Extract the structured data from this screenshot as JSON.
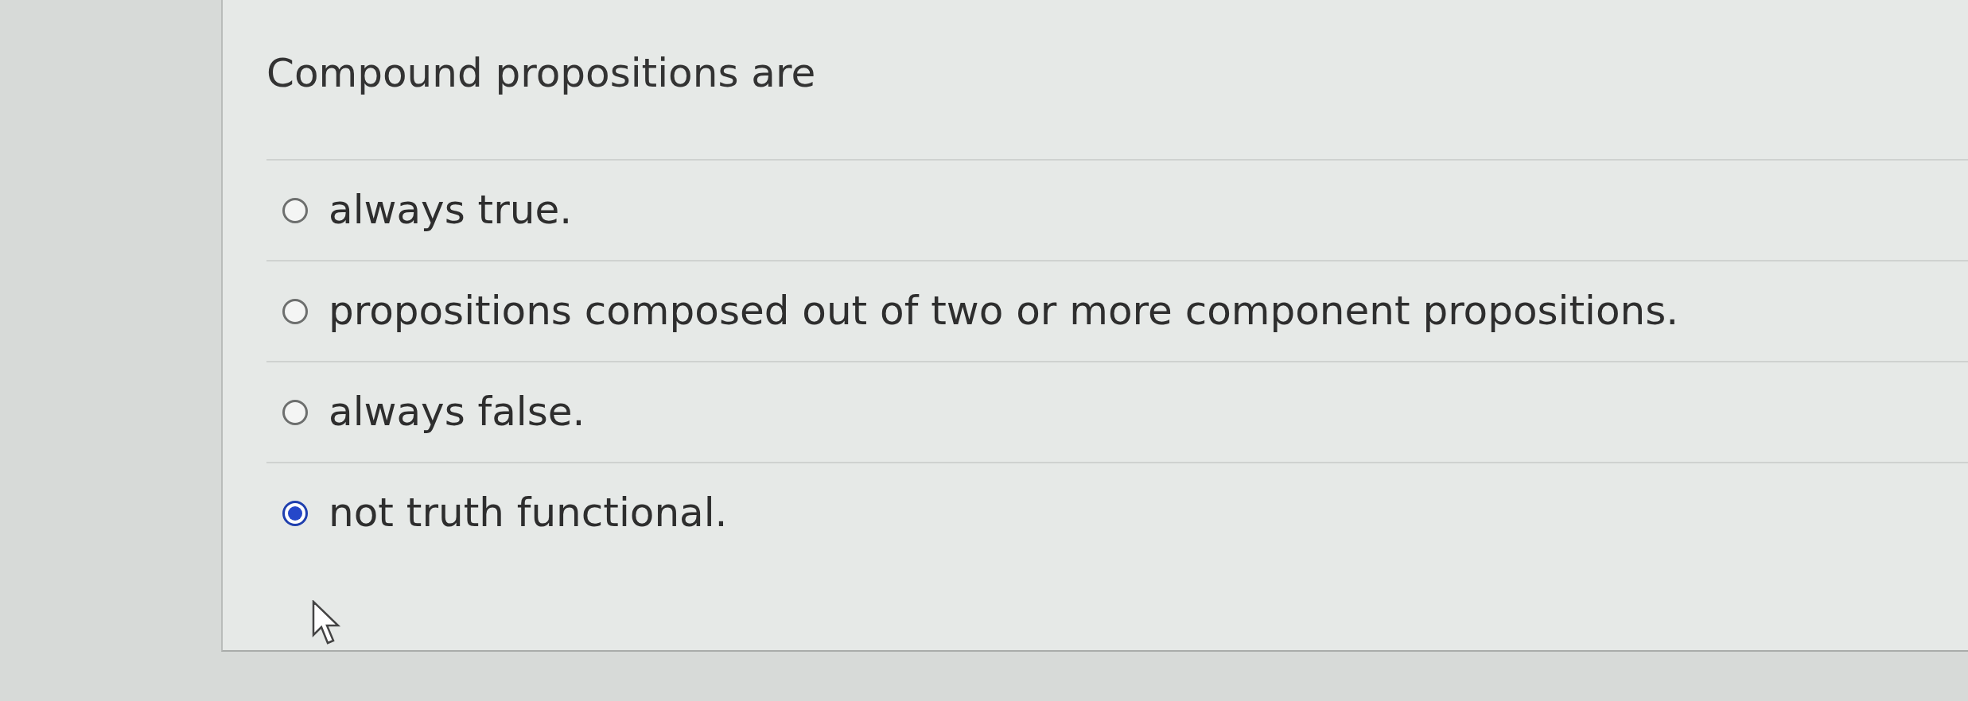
{
  "question": "Compound propositions are",
  "options": [
    {
      "label": "always true.",
      "selected": false
    },
    {
      "label": "propositions composed out of two or more component propositions.",
      "selected": false
    },
    {
      "label": "always false.",
      "selected": false
    },
    {
      "label": "not truth functional.",
      "selected": true
    }
  ]
}
